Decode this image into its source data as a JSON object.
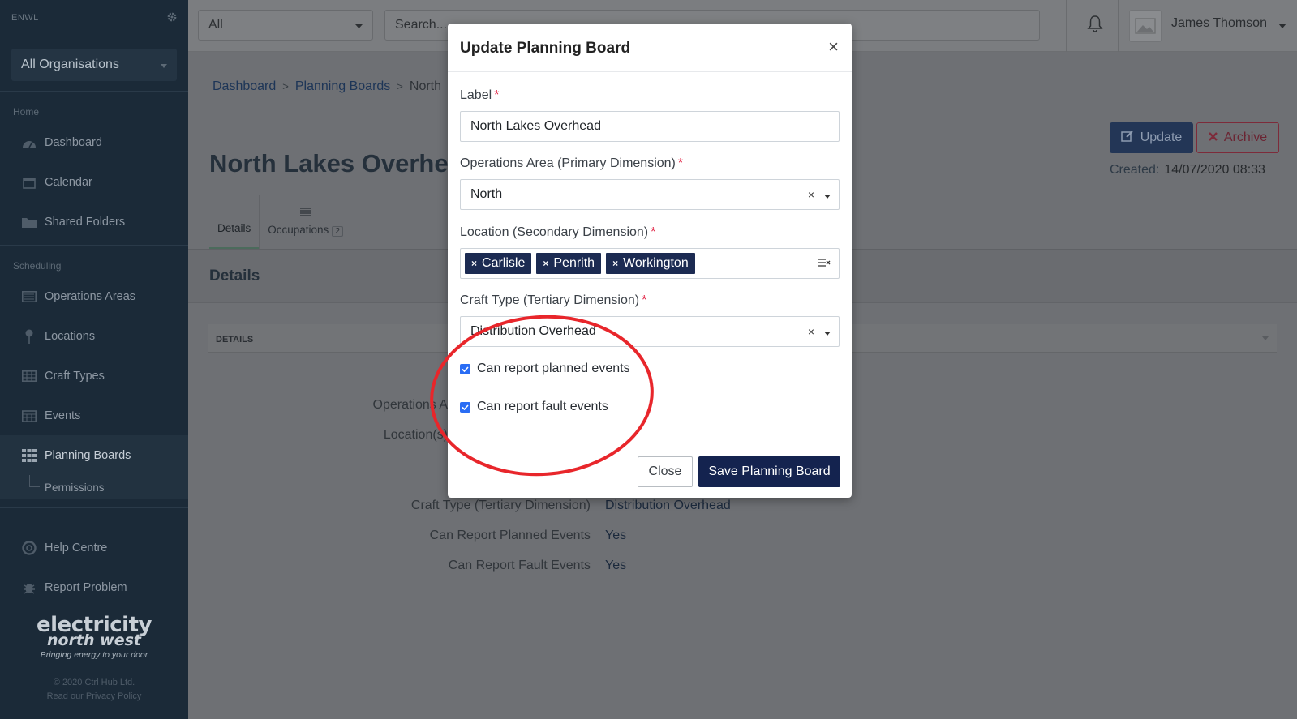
{
  "sidebar": {
    "brand": "ENWL",
    "org_selector": "All Organisations",
    "section_home": "Home",
    "section_scheduling": "Scheduling",
    "items": [
      {
        "label": "Dashboard",
        "icon": "dashboard-icon"
      },
      {
        "label": "Calendar",
        "icon": "calendar-icon"
      },
      {
        "label": "Shared Folders",
        "icon": "folder-icon"
      },
      {
        "label": "Operations Areas",
        "icon": "map-icon"
      },
      {
        "label": "Locations",
        "icon": "pin-icon"
      },
      {
        "label": "Craft Types",
        "icon": "table-icon"
      },
      {
        "label": "Events",
        "icon": "calendar-grid-icon"
      },
      {
        "label": "Planning Boards",
        "icon": "grid-icon"
      }
    ],
    "sub_permissions": "Permissions",
    "help_centre": "Help Centre",
    "report_problem": "Report Problem",
    "logo_line1": "electricity",
    "logo_line2": "north west",
    "logo_tagline": "Bringing energy to your door",
    "copyright": "© 2020 Ctrl Hub Ltd.",
    "privacy_prefix": "Read our",
    "privacy_link": "Privacy Policy"
  },
  "topbar": {
    "filter_value": "All",
    "search_placeholder": "Search...",
    "user_name": "James Thomson"
  },
  "page": {
    "breadcrumbs": [
      "Dashboard",
      "Planning Boards",
      "North"
    ],
    "title": "North Lakes Overhea",
    "update_button": "Update",
    "archive_button": "Archive",
    "created_label": "Created:",
    "created_value": "14/07/2020 08:33",
    "tabs": [
      {
        "label": "Details"
      },
      {
        "label": "Occupations",
        "badge": "2"
      }
    ],
    "details_heading": "Details",
    "panel_heading": "DETAILS",
    "fields": {
      "operations_area_label": "Operations A",
      "locations_label": "Location(s)",
      "craft_type_label": "Craft Type (Tertiary Dimension)",
      "craft_type_value": "Distribution Overhead",
      "planned_label": "Can Report Planned Events",
      "planned_value": "Yes",
      "fault_label": "Can Report Fault Events",
      "fault_value": "Yes"
    }
  },
  "modal": {
    "title": "Update Planning Board",
    "label_field": {
      "label": "Label",
      "value": "North Lakes Overhead"
    },
    "operations_area": {
      "label": "Operations Area (Primary Dimension)",
      "value": "North"
    },
    "location": {
      "label": "Location (Secondary Dimension)",
      "tags": [
        "Carlisle",
        "Penrith",
        "Workington"
      ]
    },
    "craft_type": {
      "label": "Craft Type (Tertiary Dimension)",
      "value": "Distribution Overhead"
    },
    "checkbox_planned": {
      "label": "Can report planned events",
      "checked": true
    },
    "checkbox_fault": {
      "label": "Can report fault events",
      "checked": true
    },
    "close_button": "Close",
    "save_button": "Save Planning Board"
  },
  "colors": {
    "sidebar_bg": "#1b2a38",
    "primary_navy": "#14234f",
    "checkbox_blue": "#2a6df4",
    "required_red": "#e0173a",
    "annotation_red": "#e8262b"
  }
}
